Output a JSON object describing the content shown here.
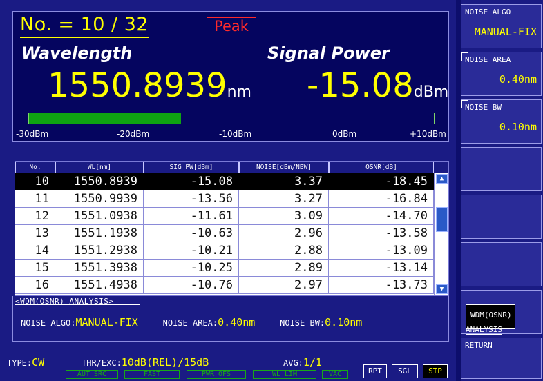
{
  "header": {
    "number_text": "No. = 10 / 32",
    "peak_label": "Peak",
    "wavelength_label": "Wavelength",
    "signal_power_label": "Signal Power",
    "wavelength_value": "1550.8939",
    "wavelength_unit": "nm",
    "signal_power_value": "-15.08",
    "signal_power_unit": "dBm"
  },
  "level_bar": {
    "fill_fraction": 0.375,
    "fill_color": "#0fa312",
    "scale_labels": [
      "-30dBm",
      "-20dBm",
      "-10dBm",
      "0dBm",
      "+10dBm"
    ]
  },
  "table": {
    "columns": [
      "No.",
      "WL[nm]",
      "SIG PW[dBm]",
      "NOISE[dBm/NBW]",
      "OSNR[dB]"
    ],
    "selected_index": 0,
    "rows": [
      [
        "10",
        "1550.8939",
        "-15.08",
        "3.37",
        "-18.45"
      ],
      [
        "11",
        "1550.9939",
        "-13.56",
        "3.27",
        "-16.84"
      ],
      [
        "12",
        "1551.0938",
        "-11.61",
        "3.09",
        "-14.70"
      ],
      [
        "13",
        "1551.1938",
        "-10.63",
        "2.96",
        "-13.58"
      ],
      [
        "14",
        "1551.2938",
        "-10.21",
        "2.88",
        "-13.09"
      ],
      [
        "15",
        "1551.3938",
        "-10.25",
        "2.89",
        "-13.14"
      ],
      [
        "16",
        "1551.4938",
        "-10.76",
        "2.97",
        "-13.73"
      ]
    ],
    "scroll_up_icon": "▲",
    "scroll_down_icon": "▼"
  },
  "analysis": {
    "title": "<WDM(OSNR) ANALYSIS>",
    "noise_algo_key": "NOISE ALGO:",
    "noise_algo_value": "MANUAL-FIX",
    "noise_area_key": "NOISE AREA:",
    "noise_area_value": "0.40nm",
    "noise_bw_key": "NOISE BW:",
    "noise_bw_value": "0.10nm"
  },
  "status": {
    "type_key": "TYPE:",
    "type_value": "CW",
    "thr_key": "THR/EXC:",
    "thr_value": "10dB(REL)/15dB",
    "avg_key": "AVG:",
    "avg_value": "1/1",
    "indicators": [
      "AUT SRC",
      "FAST",
      "PWR OFS",
      "WL LIM",
      "VAC"
    ],
    "modes": [
      "RPT",
      "SGL",
      "STP"
    ],
    "active_mode": "STP"
  },
  "softkeys": {
    "noise_algo_title": "NOISE ALGO",
    "noise_algo_value": "MANUAL-FIX",
    "noise_area_title": "NOISE AREA",
    "noise_area_value": "0.40nm",
    "noise_bw_title": "NOISE BW",
    "noise_bw_value": "0.10nm",
    "wdm_label": "WDM(OSNR)",
    "analysis_label": "ANALYSIS",
    "return_label": "RETURN"
  }
}
